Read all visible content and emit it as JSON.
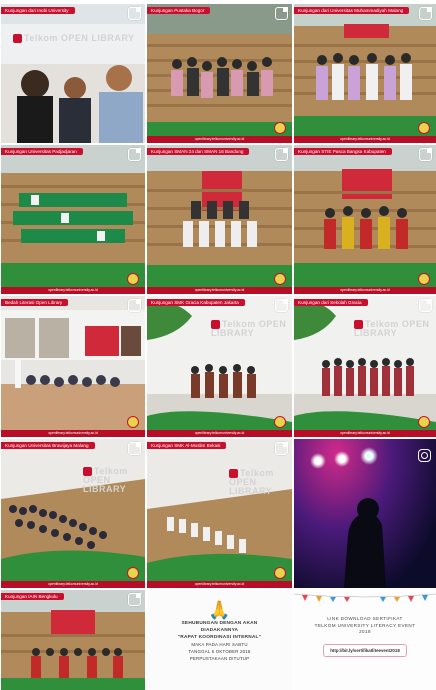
{
  "palette": {
    "accent_red": "#c8102e",
    "seat_red": "#d02a3a",
    "stair_wood": "#b08a5a",
    "grass": "#2f8f3a"
  },
  "footer_url": "openlibrary.telkomuniversity.ac.id",
  "brand_text": "Telkom OPEN LIBRARY",
  "tiles": [
    {
      "id": "t1",
      "caption": "Kunjungan dari Inobi University",
      "kind": "selfie"
    },
    {
      "id": "t2",
      "caption": "Kunjungan Pustaka Bogor",
      "kind": "stairs"
    },
    {
      "id": "t3",
      "caption": "Kunjungan dari Universitas Muhammadiyah Malang",
      "kind": "stairs"
    },
    {
      "id": "t4",
      "caption": "Kunjungan Universitas Padjadjaran",
      "kind": "stairs"
    },
    {
      "id": "t5",
      "caption": "Kunjungan SMAN 24 dan SMAN 16 Bandung",
      "kind": "stairs"
    },
    {
      "id": "t6",
      "caption": "Kunjungan STIE Pasca Bangsa Kabupaten",
      "kind": "stairs"
    },
    {
      "id": "t7",
      "caption": "Bedah Literasi Open Library",
      "kind": "room"
    },
    {
      "id": "t8",
      "caption": "Kunjungan SMK Gracia Kabupaten Jakarta",
      "kind": "wall"
    },
    {
      "id": "t9",
      "caption": "Kunjungan dari Sekolah Gracia",
      "kind": "wall"
    },
    {
      "id": "t10",
      "caption": "Kunjungan Universitas Brawijaya Malang",
      "kind": "crowd"
    },
    {
      "id": "t11",
      "caption": "Kunjungan SMK Al-Muslim Bekasi",
      "kind": "crowd"
    },
    {
      "id": "t12",
      "caption": "",
      "kind": "concert"
    },
    {
      "id": "t13",
      "caption": "Kunjungan IAIN Bengkulu",
      "kind": "stairs"
    },
    {
      "id": "t14",
      "caption": "",
      "kind": "notice"
    },
    {
      "id": "t15",
      "caption": "",
      "kind": "certificate"
    }
  ],
  "notice": {
    "line1": "SEHUBUNGAN DENGAN AKAN",
    "line2": "DIADAKANNYA",
    "line3": "\"RAPAT KOORDINASI INTERNAL\"",
    "line4": "MAKA PADA HARI SABTU",
    "line5": "TANGGAL 6 OKTOBER 2018",
    "line6": "PERPUSTAKAAN DITUTUP"
  },
  "certificate": {
    "line1": "LINK DOWNLOAD SERTIFIKAT",
    "line2": "TELKOM UNIVERSITY LITERACY EVENT",
    "line3": "2018",
    "link": "http://bit.ly/sertifikatliteevent2018"
  }
}
